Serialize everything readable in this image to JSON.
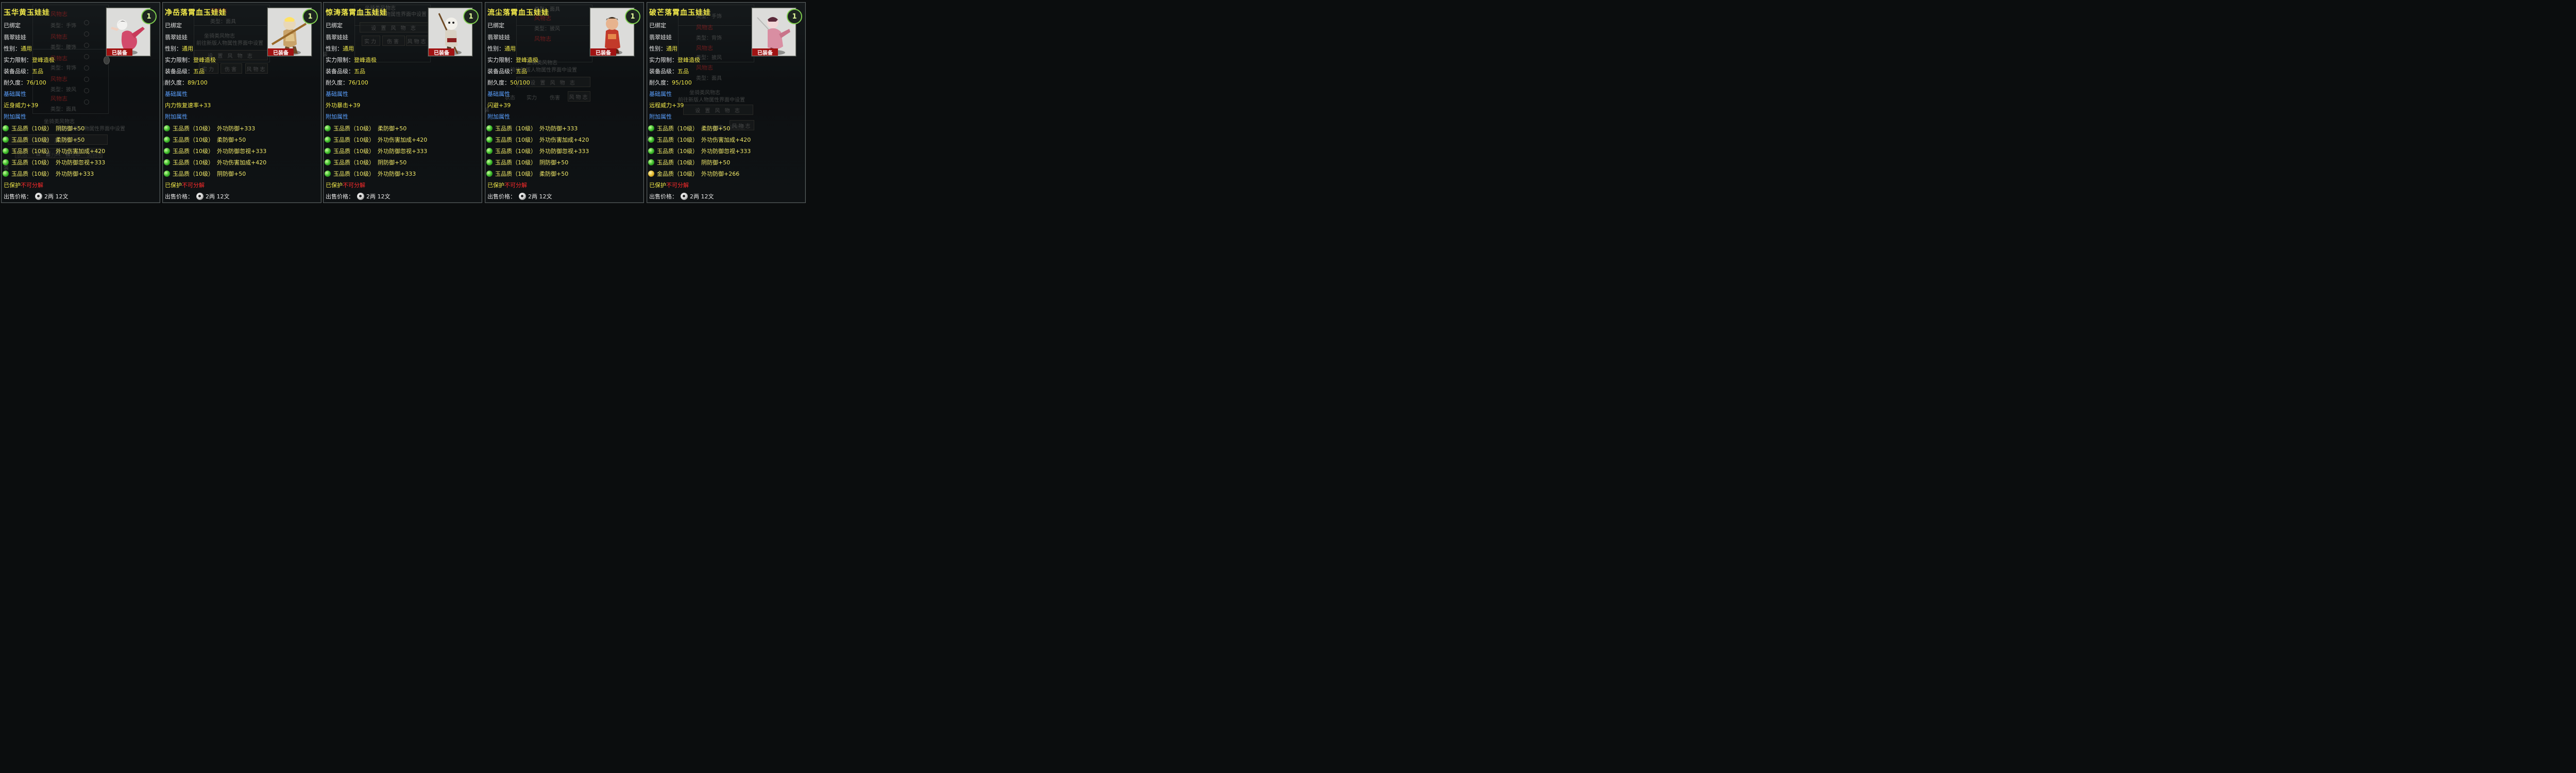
{
  "labels": {
    "bound": "已绑定",
    "doll_type": "翡翠娃娃",
    "gender_label": "性别：",
    "gender_value": "通用",
    "level_label": "实力限制：",
    "level_value": "登峰造极",
    "grade_label": "装备品级：",
    "grade_value": "五品",
    "durability_label": "耐久度：",
    "base_attr": "基础属性",
    "extra_attr": "附加属性",
    "protected": "已保护",
    "no_dismantle": "不可分解",
    "price_label": "出售价格：",
    "price_value": "2两 12文",
    "equipped": "已装备",
    "badge": "1"
  },
  "ghost": {
    "mount_title": "坐骑类风物志",
    "mount_hint": "前往新版人物属性界面中设置",
    "set_button": "设 置 风 物 志",
    "tab_strength": "实力",
    "tab_damage": "伤害",
    "tab_fengwu": "风物志",
    "tab_state": "状态",
    "fengwu": "风物志",
    "type_accessory": "类型：手饰",
    "type_waist": "类型：腰饰",
    "type_back": "类型：背饰",
    "type_cloak": "类型：披风",
    "type_mask": "类型：面具",
    "zhuang": "装"
  },
  "panels": [
    {
      "title": "玉华黄玉娃娃",
      "durability": "76/100",
      "base": "近身威力+39",
      "gems": [
        {
          "grade": "玉品质（10级）",
          "stat": "阴防御+50",
          "kind": "jade"
        },
        {
          "grade": "玉品质（10级）",
          "stat": "柔防御+50",
          "kind": "jade"
        },
        {
          "grade": "玉品质（10级）",
          "stat": "外功伤害加成+420",
          "kind": "jade"
        },
        {
          "grade": "玉品质（10级）",
          "stat": "外功防御忽视+333",
          "kind": "jade"
        },
        {
          "grade": "玉品质（10级）",
          "stat": "外功防御+333",
          "kind": "jade"
        }
      ]
    },
    {
      "title": "净岳落霄血玉娃娃",
      "durability": "89/100",
      "base": "内力恢复速率+33",
      "gems": [
        {
          "grade": "玉品质（10级）",
          "stat": "外功防御+333",
          "kind": "jade"
        },
        {
          "grade": "玉品质（10级）",
          "stat": "柔防御+50",
          "kind": "jade"
        },
        {
          "grade": "玉品质（10级）",
          "stat": "外功防御忽视+333",
          "kind": "jade"
        },
        {
          "grade": "玉品质（10级）",
          "stat": "外功伤害加成+420",
          "kind": "jade"
        },
        {
          "grade": "玉品质（10级）",
          "stat": "阴防御+50",
          "kind": "jade"
        }
      ]
    },
    {
      "title": "惊涛落霄血玉娃娃",
      "durability": "76/100",
      "base": "外功暴击+39",
      "gems": [
        {
          "grade": "玉品质（10级）",
          "stat": "柔防御+50",
          "kind": "jade"
        },
        {
          "grade": "玉品质（10级）",
          "stat": "外功伤害加成+420",
          "kind": "jade"
        },
        {
          "grade": "玉品质（10级）",
          "stat": "外功防御忽视+333",
          "kind": "jade"
        },
        {
          "grade": "玉品质（10级）",
          "stat": "阴防御+50",
          "kind": "jade"
        },
        {
          "grade": "玉品质（10级）",
          "stat": "外功防御+333",
          "kind": "jade"
        }
      ]
    },
    {
      "title": "流尘落霄血玉娃娃",
      "durability": "50/100",
      "base": "闪避+39",
      "gems": [
        {
          "grade": "玉品质（10级）",
          "stat": "外功防御+333",
          "kind": "jade"
        },
        {
          "grade": "玉品质（10级）",
          "stat": "外功伤害加成+420",
          "kind": "jade"
        },
        {
          "grade": "玉品质（10级）",
          "stat": "外功防御忽视+333",
          "kind": "jade"
        },
        {
          "grade": "玉品质（10级）",
          "stat": "阴防御+50",
          "kind": "jade"
        },
        {
          "grade": "玉品质（10级）",
          "stat": "柔防御+50",
          "kind": "jade"
        }
      ]
    },
    {
      "title": "破芒落霄血玉娃娃",
      "durability": "95/100",
      "base": "远程威力+39",
      "gems": [
        {
          "grade": "玉品质（10级）",
          "stat": "柔防御+50",
          "kind": "jade"
        },
        {
          "grade": "玉品质（10级）",
          "stat": "外功伤害加成+420",
          "kind": "jade"
        },
        {
          "grade": "玉品质（10级）",
          "stat": "外功防御忽视+333",
          "kind": "jade"
        },
        {
          "grade": "玉品质（10级）",
          "stat": "阴防御+50",
          "kind": "jade"
        },
        {
          "grade": "金品质（10级）",
          "stat": "外功防御+266",
          "kind": "gold"
        }
      ]
    }
  ],
  "doll_figures": [
    "pink-fighter-doll",
    "monkey-staff-doll",
    "monkey-spear-doll",
    "red-warrior-doll",
    "pink-sword-doll"
  ]
}
